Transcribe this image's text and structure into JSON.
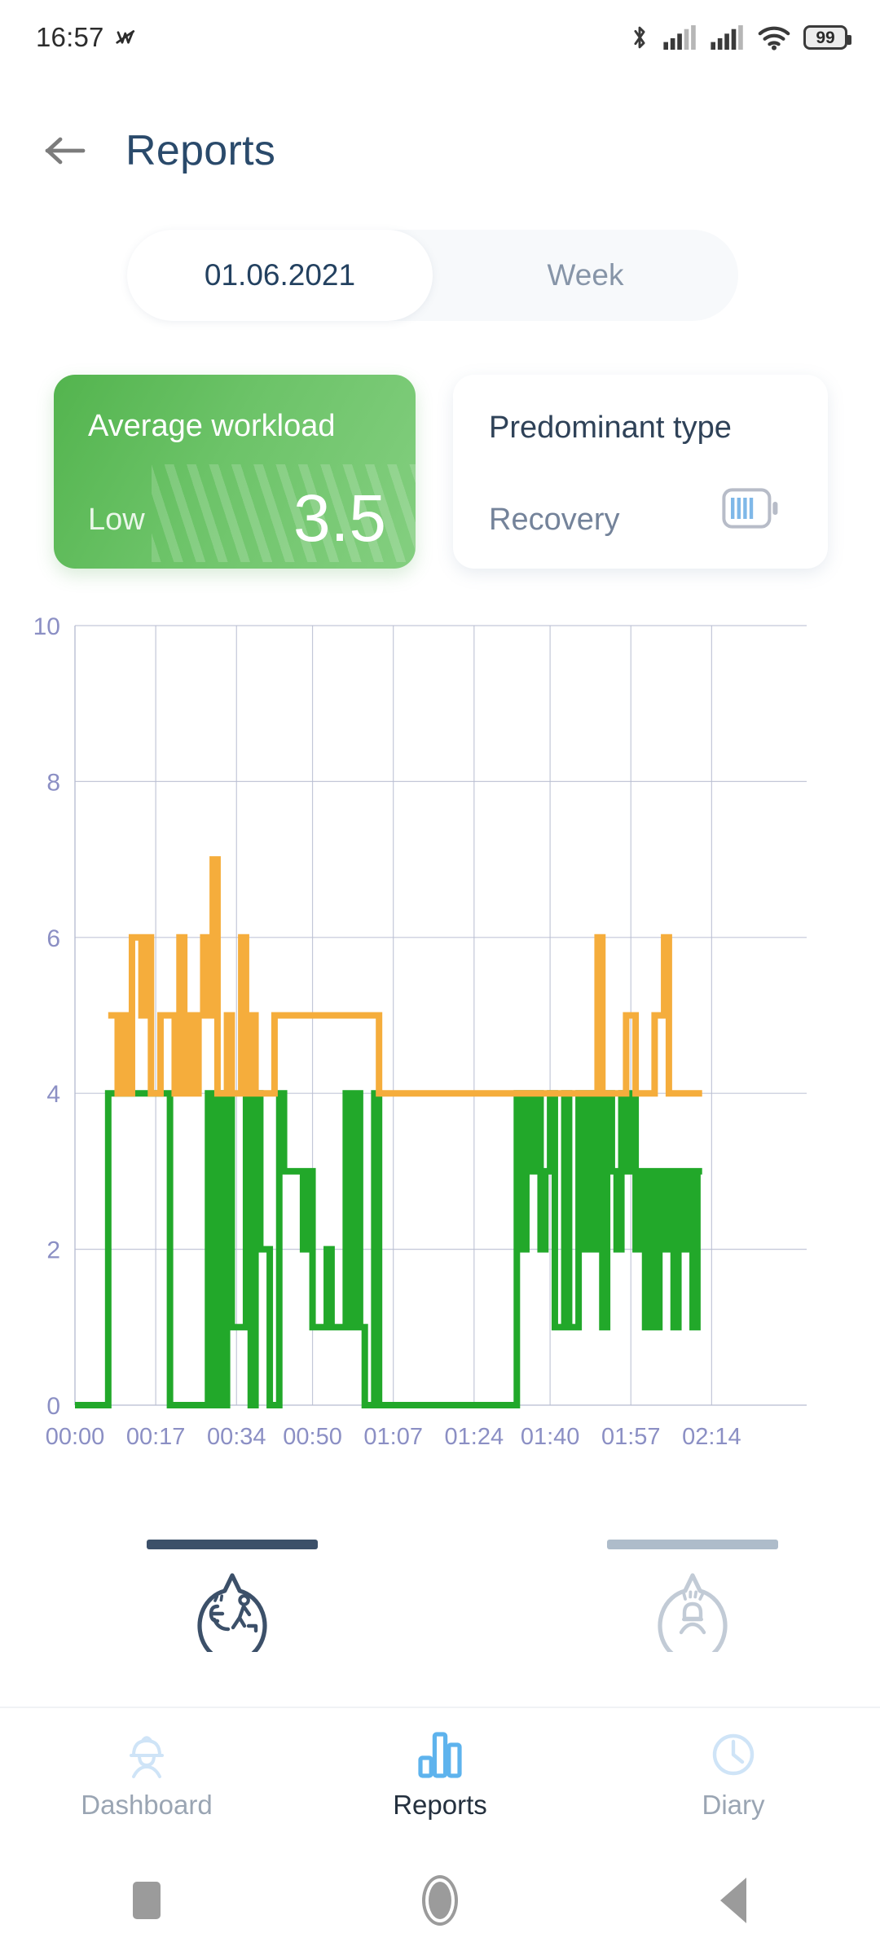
{
  "statusbar": {
    "time": "16:57",
    "icons": [
      "mute-icon",
      "bluetooth-icon",
      "signal-sim1-icon",
      "signal-sim2-icon",
      "wifi-icon"
    ],
    "battery_level": "99"
  },
  "header": {
    "back_icon": "back-arrow-icon",
    "title": "Reports",
    "title_color": "#2a4a6b"
  },
  "segmented": {
    "options": [
      {
        "label": "01.06.2021",
        "selected": true
      },
      {
        "label": "Week",
        "selected": false
      }
    ]
  },
  "cards": {
    "workload": {
      "title": "Average workload",
      "level": "Low",
      "value": "3.5",
      "accent": "#6cc368"
    },
    "predominant": {
      "title": "Predominant type",
      "value": "Recovery",
      "icon": "battery-recovery-icon",
      "icon_color": "#7fb8e8"
    }
  },
  "chart_data": {
    "type": "line",
    "title": "",
    "xlabel": "",
    "ylabel": "",
    "ylim": [
      0,
      10
    ],
    "xlim": [
      0,
      154
    ],
    "grid": true,
    "legend": "none",
    "yticks": [
      0,
      2,
      4,
      6,
      8,
      10
    ],
    "xtick_labels": [
      "00:00",
      "00:17",
      "00:34",
      "00:50",
      "01:07",
      "01:24",
      "01:40",
      "01:57",
      "02:14"
    ],
    "xtick_minutes": [
      0,
      17,
      34,
      50,
      67,
      84,
      100,
      117,
      134
    ],
    "tick_color": "#8b8fc4",
    "grid_color": "#b9bed2",
    "series": [
      {
        "name": "workload",
        "color": "#22a82a",
        "step": true,
        "points": [
          [
            0,
            0
          ],
          [
            7,
            0
          ],
          [
            7,
            4
          ],
          [
            20,
            4
          ],
          [
            20,
            0
          ],
          [
            28,
            0
          ],
          [
            28,
            4
          ],
          [
            29,
            4
          ],
          [
            29,
            0
          ],
          [
            30,
            0
          ],
          [
            30,
            4
          ],
          [
            31,
            4
          ],
          [
            31,
            0
          ],
          [
            32,
            0
          ],
          [
            32,
            4
          ],
          [
            33,
            4
          ],
          [
            33,
            1
          ],
          [
            36,
            1
          ],
          [
            36,
            4
          ],
          [
            37,
            4
          ],
          [
            37,
            0
          ],
          [
            38,
            0
          ],
          [
            38,
            4
          ],
          [
            39,
            4
          ],
          [
            39,
            2
          ],
          [
            41,
            2
          ],
          [
            41,
            0
          ],
          [
            43,
            0
          ],
          [
            43,
            4
          ],
          [
            44,
            4
          ],
          [
            44,
            3
          ],
          [
            48,
            3
          ],
          [
            48,
            2
          ],
          [
            49,
            2
          ],
          [
            49,
            3
          ],
          [
            50,
            3
          ],
          [
            50,
            1
          ],
          [
            53,
            1
          ],
          [
            53,
            2
          ],
          [
            54,
            2
          ],
          [
            54,
            1
          ],
          [
            57,
            1
          ],
          [
            57,
            4
          ],
          [
            58,
            4
          ],
          [
            58,
            1
          ],
          [
            59,
            1
          ],
          [
            59,
            4
          ],
          [
            60,
            4
          ],
          [
            60,
            1
          ],
          [
            61,
            1
          ],
          [
            61,
            0
          ],
          [
            63,
            0
          ],
          [
            63,
            4
          ],
          [
            64,
            4
          ],
          [
            64,
            0
          ],
          [
            93,
            0
          ],
          [
            93,
            4
          ],
          [
            94,
            4
          ],
          [
            94,
            2
          ],
          [
            95,
            2
          ],
          [
            95,
            4
          ],
          [
            96,
            4
          ],
          [
            96,
            3
          ],
          [
            97,
            3
          ],
          [
            97,
            4
          ],
          [
            98,
            4
          ],
          [
            98,
            2
          ],
          [
            99,
            2
          ],
          [
            99,
            3
          ],
          [
            100,
            3
          ],
          [
            100,
            4
          ],
          [
            101,
            4
          ],
          [
            101,
            1
          ],
          [
            103,
            1
          ],
          [
            103,
            4
          ],
          [
            104,
            4
          ],
          [
            104,
            1
          ],
          [
            106,
            1
          ],
          [
            106,
            4
          ],
          [
            107,
            4
          ],
          [
            107,
            2
          ],
          [
            108,
            2
          ],
          [
            108,
            4
          ],
          [
            109,
            4
          ],
          [
            109,
            2
          ],
          [
            110,
            2
          ],
          [
            110,
            4
          ],
          [
            111,
            4
          ],
          [
            111,
            1
          ],
          [
            112,
            1
          ],
          [
            112,
            4
          ],
          [
            113,
            4
          ],
          [
            113,
            3
          ],
          [
            114,
            3
          ],
          [
            114,
            2
          ],
          [
            115,
            2
          ],
          [
            115,
            4
          ],
          [
            116,
            4
          ],
          [
            116,
            3
          ],
          [
            117,
            3
          ],
          [
            117,
            4
          ],
          [
            118,
            4
          ],
          [
            118,
            2
          ],
          [
            119,
            2
          ],
          [
            119,
            3
          ],
          [
            120,
            3
          ],
          [
            120,
            1
          ],
          [
            121,
            1
          ],
          [
            121,
            3
          ],
          [
            122,
            3
          ],
          [
            122,
            1
          ],
          [
            123,
            1
          ],
          [
            123,
            3
          ],
          [
            124,
            3
          ],
          [
            124,
            2
          ],
          [
            125,
            2
          ],
          [
            125,
            3
          ],
          [
            126,
            3
          ],
          [
            126,
            1
          ],
          [
            127,
            1
          ],
          [
            127,
            3
          ],
          [
            128,
            3
          ],
          [
            128,
            2
          ],
          [
            129,
            2
          ],
          [
            129,
            3
          ],
          [
            130,
            3
          ],
          [
            130,
            1
          ],
          [
            131,
            1
          ],
          [
            131,
            3
          ],
          [
            132,
            3
          ]
        ]
      },
      {
        "name": "recovery",
        "color": "#f5ad3c",
        "step": true,
        "points": [
          [
            7,
            5
          ],
          [
            9,
            5
          ],
          [
            9,
            4
          ],
          [
            10,
            4
          ],
          [
            10,
            5
          ],
          [
            11,
            5
          ],
          [
            11,
            4
          ],
          [
            12,
            4
          ],
          [
            12,
            6
          ],
          [
            14,
            6
          ],
          [
            14,
            5
          ],
          [
            15,
            5
          ],
          [
            15,
            6
          ],
          [
            16,
            6
          ],
          [
            16,
            4
          ],
          [
            18,
            4
          ],
          [
            18,
            5
          ],
          [
            21,
            5
          ],
          [
            21,
            4
          ],
          [
            22,
            4
          ],
          [
            22,
            6
          ],
          [
            23,
            6
          ],
          [
            23,
            4
          ],
          [
            24,
            4
          ],
          [
            24,
            5
          ],
          [
            25,
            5
          ],
          [
            25,
            4
          ],
          [
            26,
            4
          ],
          [
            26,
            5
          ],
          [
            27,
            5
          ],
          [
            27,
            6
          ],
          [
            28,
            6
          ],
          [
            28,
            5
          ],
          [
            29,
            5
          ],
          [
            29,
            7
          ],
          [
            30,
            7
          ],
          [
            30,
            4
          ],
          [
            32,
            4
          ],
          [
            32,
            5
          ],
          [
            33,
            5
          ],
          [
            33,
            4
          ],
          [
            35,
            4
          ],
          [
            35,
            6
          ],
          [
            36,
            6
          ],
          [
            36,
            4
          ],
          [
            37,
            4
          ],
          [
            37,
            5
          ],
          [
            38,
            5
          ],
          [
            38,
            4
          ],
          [
            42,
            4
          ],
          [
            42,
            5
          ],
          [
            64,
            5
          ],
          [
            64,
            4
          ],
          [
            93,
            4
          ],
          [
            110,
            4
          ],
          [
            110,
            6
          ],
          [
            111,
            6
          ],
          [
            111,
            4
          ],
          [
            116,
            4
          ],
          [
            116,
            5
          ],
          [
            118,
            5
          ],
          [
            118,
            4
          ],
          [
            122,
            4
          ],
          [
            122,
            5
          ],
          [
            124,
            5
          ],
          [
            124,
            6
          ],
          [
            125,
            6
          ],
          [
            125,
            4
          ],
          [
            132,
            4
          ]
        ]
      }
    ]
  },
  "chart_tabs": [
    {
      "name": "workload-tab",
      "icon": "activity-badge-icon",
      "active": true,
      "bar_color": "#3c5069"
    },
    {
      "name": "stress-tab",
      "icon": "stress-badge-icon",
      "active": false,
      "bar_color": "#aebcca"
    }
  ],
  "bottom_nav": [
    {
      "label": "Dashboard",
      "icon": "worker-helmet-icon",
      "active": false
    },
    {
      "label": "Reports",
      "icon": "bar-chart-icon",
      "active": true
    },
    {
      "label": "Diary",
      "icon": "clock-icon",
      "active": false
    }
  ],
  "android_nav": [
    {
      "name": "recents-button",
      "icon": "square-icon"
    },
    {
      "name": "home-button",
      "icon": "circle-icon"
    },
    {
      "name": "back-button",
      "icon": "triangle-left-icon"
    }
  ]
}
